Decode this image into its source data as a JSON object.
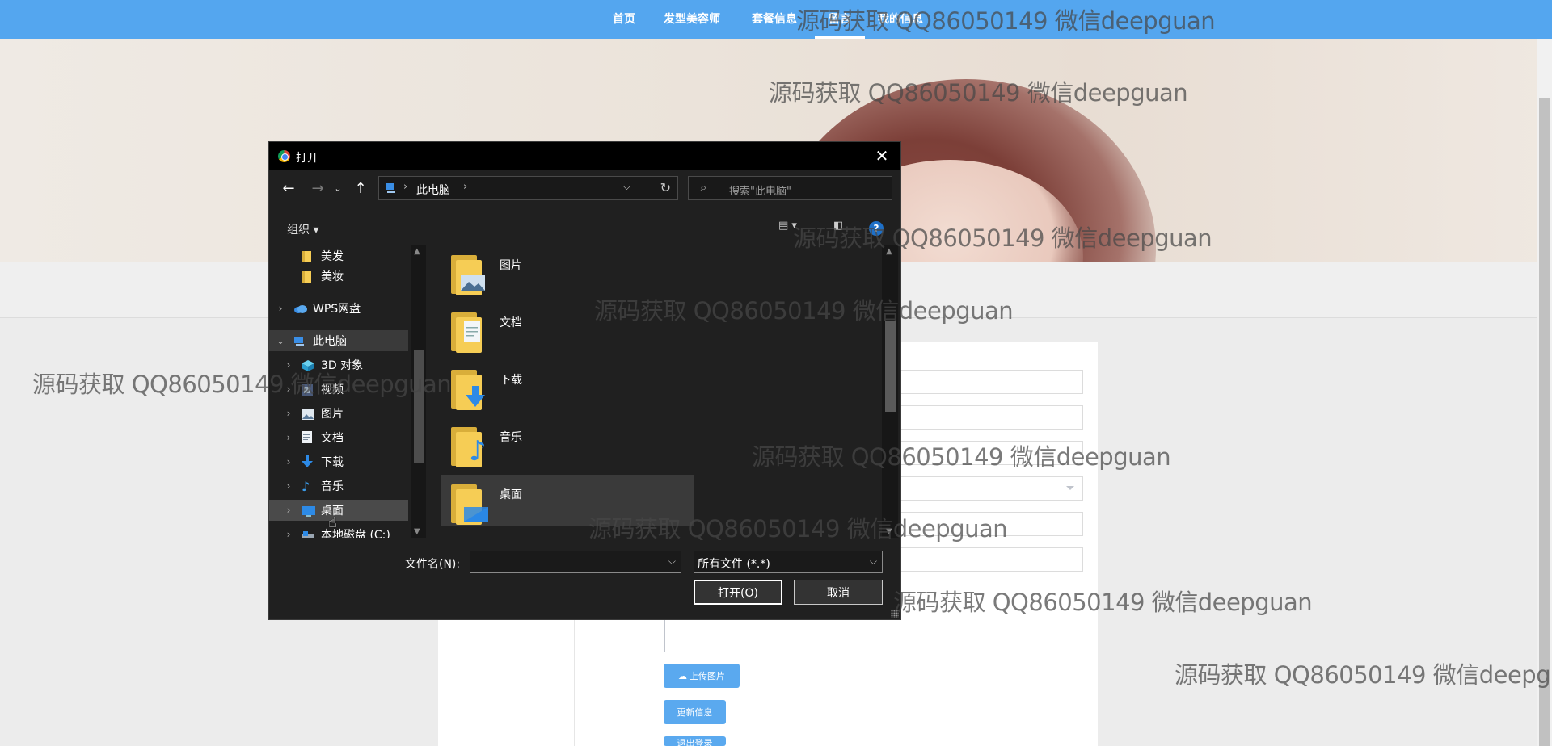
{
  "colors": {
    "nav_bg": "#54a6ef",
    "dialog_bg": "#202020",
    "accent_button": "#5aa9ef"
  },
  "topnav": {
    "items": [
      {
        "label": "首页"
      },
      {
        "label": "发型美容师"
      },
      {
        "label": "套餐信息"
      },
      {
        "label": "留言"
      },
      {
        "label": "我的信息"
      }
    ],
    "active": "留言"
  },
  "page": {
    "upload_button": "上传图片",
    "update_button": "更新信息",
    "logout_button": "退出登录"
  },
  "watermark_text": "源码获取 QQ86050149 微信deepguan",
  "dialog": {
    "title": "打开",
    "close_icon": "close-icon",
    "address_path": "此电脑",
    "search_placeholder": "搜索\"此电脑\"",
    "organize_label": "组织",
    "help_label": "?",
    "nav_tree": [
      {
        "label": "美发",
        "icon": "folder-icon",
        "level": 2,
        "expand": ""
      },
      {
        "label": "美妆",
        "icon": "folder-icon",
        "level": 2,
        "expand": ""
      },
      {
        "label": "WPS网盘",
        "icon": "cloud-icon",
        "level": 1,
        "expand": ">"
      },
      {
        "label": "此电脑",
        "icon": "pc-icon",
        "level": 1,
        "expand": "v",
        "selected": true
      },
      {
        "label": "3D 对象",
        "icon": "cube-icon",
        "level": 2,
        "expand": ">"
      },
      {
        "label": "视频",
        "icon": "video-icon",
        "level": 2,
        "expand": ">"
      },
      {
        "label": "图片",
        "icon": "pictures-icon",
        "level": 2,
        "expand": ">"
      },
      {
        "label": "文档",
        "icon": "documents-icon",
        "level": 2,
        "expand": ">"
      },
      {
        "label": "下载",
        "icon": "download-icon",
        "level": 2,
        "expand": ">"
      },
      {
        "label": "音乐",
        "icon": "music-icon",
        "level": 2,
        "expand": ">"
      },
      {
        "label": "桌面",
        "icon": "desktop-icon",
        "level": 2,
        "expand": ">",
        "hover": true
      },
      {
        "label": "本地磁盘 (C:)",
        "icon": "drive-icon",
        "level": 2,
        "expand": ">"
      }
    ],
    "files": [
      {
        "label": "图片",
        "icon": "pictures-folder-icon"
      },
      {
        "label": "文档",
        "icon": "documents-folder-icon"
      },
      {
        "label": "下载",
        "icon": "downloads-folder-icon"
      },
      {
        "label": "音乐",
        "icon": "music-folder-icon"
      },
      {
        "label": "桌面",
        "icon": "desktop-folder-icon",
        "selected": true
      }
    ],
    "filename_label": "文件名(N):",
    "filename_value": "",
    "filetype_value": "所有文件 (*.*)",
    "open_button": "打开(O)",
    "cancel_button": "取消"
  }
}
